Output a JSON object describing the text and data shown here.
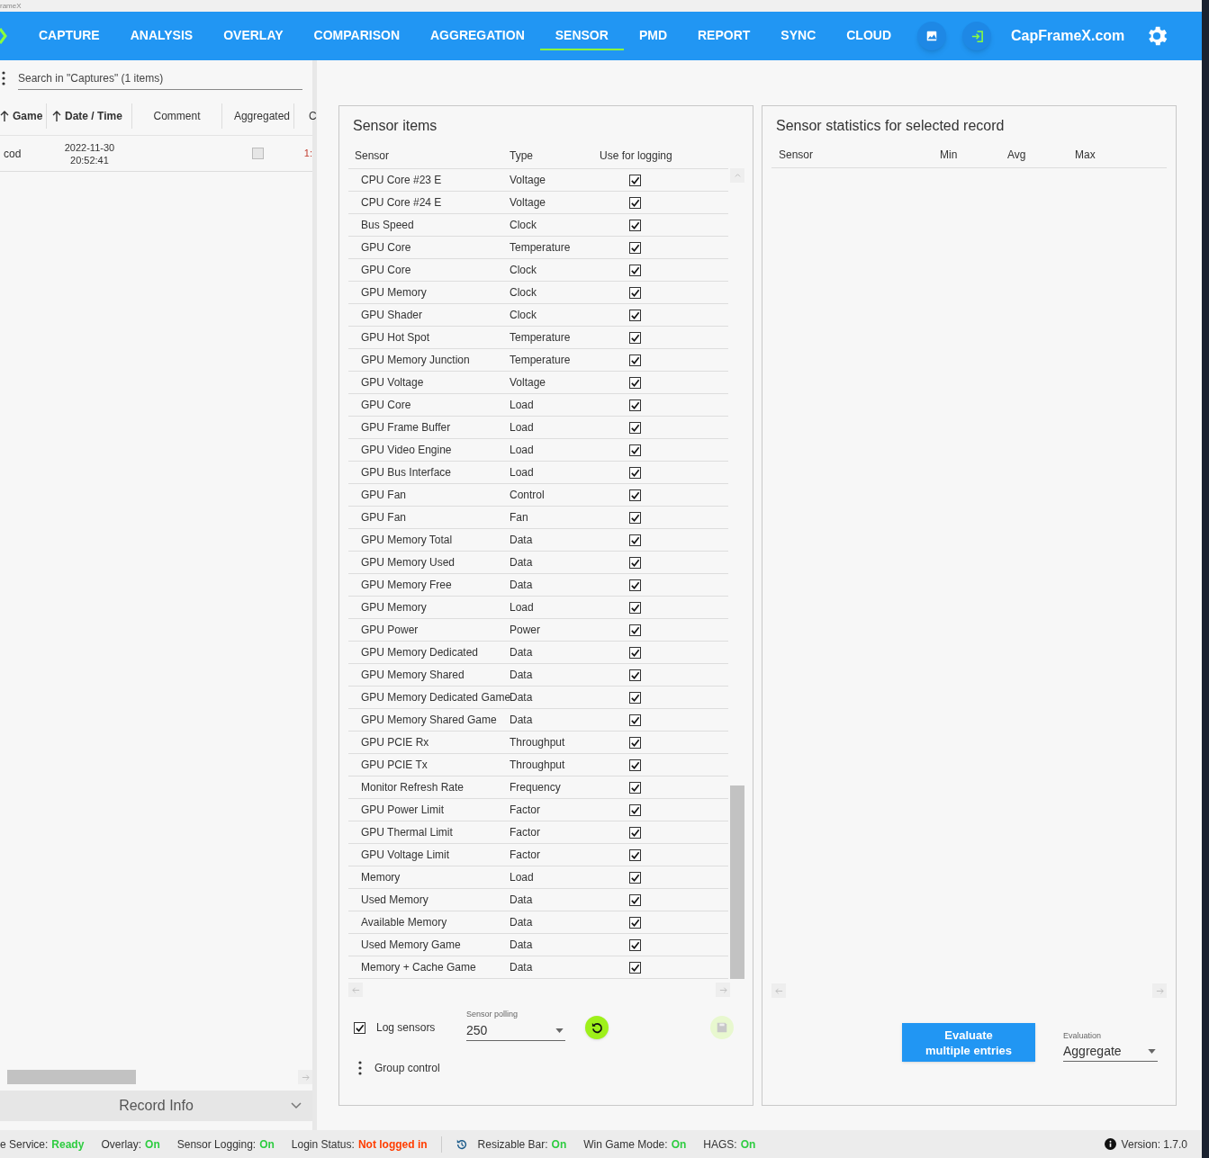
{
  "window": {
    "title": "rameX"
  },
  "nav": {
    "tabs": [
      {
        "label": "CAPTURE",
        "selected": false
      },
      {
        "label": "ANALYSIS",
        "selected": false
      },
      {
        "label": "OVERLAY",
        "selected": false
      },
      {
        "label": "COMPARISON",
        "selected": false
      },
      {
        "label": "AGGREGATION",
        "selected": false
      },
      {
        "label": "SENSOR",
        "selected": true
      },
      {
        "label": "PMD",
        "selected": false
      },
      {
        "label": "REPORT",
        "selected": false
      },
      {
        "label": "SYNC",
        "selected": false
      },
      {
        "label": "CLOUD",
        "selected": false
      }
    ],
    "site_link": "CapFrameX.com"
  },
  "captures": {
    "search": {
      "placeholder": "Search in \"Captures\" (1 items)"
    },
    "columns": [
      {
        "label": "Game",
        "sort_arrow": true
      },
      {
        "label": "Date / Time",
        "sort_arrow": true
      },
      {
        "label": "Comment",
        "sort_arrow": false
      },
      {
        "label": "Aggregated",
        "sort_arrow": false
      },
      {
        "label": "C",
        "sort_arrow": false
      }
    ],
    "rows": [
      {
        "game": "cod",
        "date": "2022-11-30",
        "time": "20:52:41",
        "aggregated": false,
        "column_5": "1:"
      }
    ],
    "record_info": "Record Info"
  },
  "sensor_items": {
    "title": "Sensor items",
    "columns": [
      "Sensor",
      "Type",
      "Use for logging"
    ],
    "rows": [
      {
        "sensor": "CPU Core #23 E",
        "type": "Voltage",
        "checked": true
      },
      {
        "sensor": "CPU Core #24 E",
        "type": "Voltage",
        "checked": true
      },
      {
        "sensor": "Bus Speed",
        "type": "Clock",
        "checked": true
      },
      {
        "sensor": "GPU Core",
        "type": "Temperature",
        "checked": true
      },
      {
        "sensor": "GPU Core",
        "type": "Clock",
        "checked": true
      },
      {
        "sensor": "GPU Memory",
        "type": "Clock",
        "checked": true
      },
      {
        "sensor": "GPU Shader",
        "type": "Clock",
        "checked": true
      },
      {
        "sensor": "GPU Hot Spot",
        "type": "Temperature",
        "checked": true
      },
      {
        "sensor": "GPU Memory Junction",
        "type": "Temperature",
        "checked": true
      },
      {
        "sensor": "GPU Voltage",
        "type": "Voltage",
        "checked": true
      },
      {
        "sensor": "GPU Core",
        "type": "Load",
        "checked": true
      },
      {
        "sensor": "GPU Frame Buffer",
        "type": "Load",
        "checked": true
      },
      {
        "sensor": "GPU Video Engine",
        "type": "Load",
        "checked": true
      },
      {
        "sensor": "GPU Bus Interface",
        "type": "Load",
        "checked": true
      },
      {
        "sensor": "GPU Fan",
        "type": "Control",
        "checked": true
      },
      {
        "sensor": "GPU Fan",
        "type": "Fan",
        "checked": true
      },
      {
        "sensor": "GPU Memory Total",
        "type": "Data",
        "checked": true
      },
      {
        "sensor": "GPU Memory Used",
        "type": "Data",
        "checked": true
      },
      {
        "sensor": "GPU Memory Free",
        "type": "Data",
        "checked": true
      },
      {
        "sensor": "GPU Memory",
        "type": "Load",
        "checked": true
      },
      {
        "sensor": "GPU Power",
        "type": "Power",
        "checked": true
      },
      {
        "sensor": "GPU Memory Dedicated",
        "type": "Data",
        "checked": true
      },
      {
        "sensor": "GPU Memory Shared",
        "type": "Data",
        "checked": true
      },
      {
        "sensor": "GPU Memory Dedicated Game",
        "type": "Data",
        "checked": true
      },
      {
        "sensor": "GPU Memory Shared Game",
        "type": "Data",
        "checked": true
      },
      {
        "sensor": "GPU PCIE Rx",
        "type": "Throughput",
        "checked": true
      },
      {
        "sensor": "GPU PCIE Tx",
        "type": "Throughput",
        "checked": true
      },
      {
        "sensor": "Monitor Refresh Rate",
        "type": "Frequency",
        "checked": true
      },
      {
        "sensor": "GPU Power Limit",
        "type": "Factor",
        "checked": true
      },
      {
        "sensor": "GPU Thermal Limit",
        "type": "Factor",
        "checked": true
      },
      {
        "sensor": "GPU Voltage Limit",
        "type": "Factor",
        "checked": true
      },
      {
        "sensor": "Memory",
        "type": "Load",
        "checked": true
      },
      {
        "sensor": "Used Memory",
        "type": "Data",
        "checked": true
      },
      {
        "sensor": "Available Memory",
        "type": "Data",
        "checked": true
      },
      {
        "sensor": "Used Memory Game",
        "type": "Data",
        "checked": true
      },
      {
        "sensor": "Memory + Cache Game",
        "type": "Data",
        "checked": true
      }
    ],
    "log_sensors": {
      "label": "Log sensors",
      "checked": true
    },
    "polling": {
      "label": "Sensor polling",
      "value": "250"
    },
    "group_control": "Group control"
  },
  "statistics": {
    "title": "Sensor statistics for selected record",
    "columns": [
      "Sensor",
      "Min",
      "Avg",
      "Max"
    ],
    "evaluate_button": "Evaluate\nmultiple entries",
    "evaluation": {
      "label": "Evaluation",
      "value": "Aggregate"
    }
  },
  "status_bar": {
    "items": [
      {
        "label": "e Service:",
        "value": "Ready",
        "color": "#2ecc40"
      },
      {
        "label": "Overlay:",
        "value": "On",
        "color": "#2ecc40"
      },
      {
        "label": "Sensor Logging:",
        "value": "On",
        "color": "#2ecc40"
      },
      {
        "label": "Login Status:",
        "value": "Not logged in",
        "color": "#ff3d00"
      }
    ],
    "items_after": [
      {
        "label": "Resizable Bar:",
        "value": "On",
        "color": "#2ecc40"
      },
      {
        "label": "Win Game Mode:",
        "value": "On",
        "color": "#2ecc40"
      },
      {
        "label": "HAGS:",
        "value": "On",
        "color": "#2ecc40"
      }
    ],
    "version": "Version: 1.7.0"
  }
}
